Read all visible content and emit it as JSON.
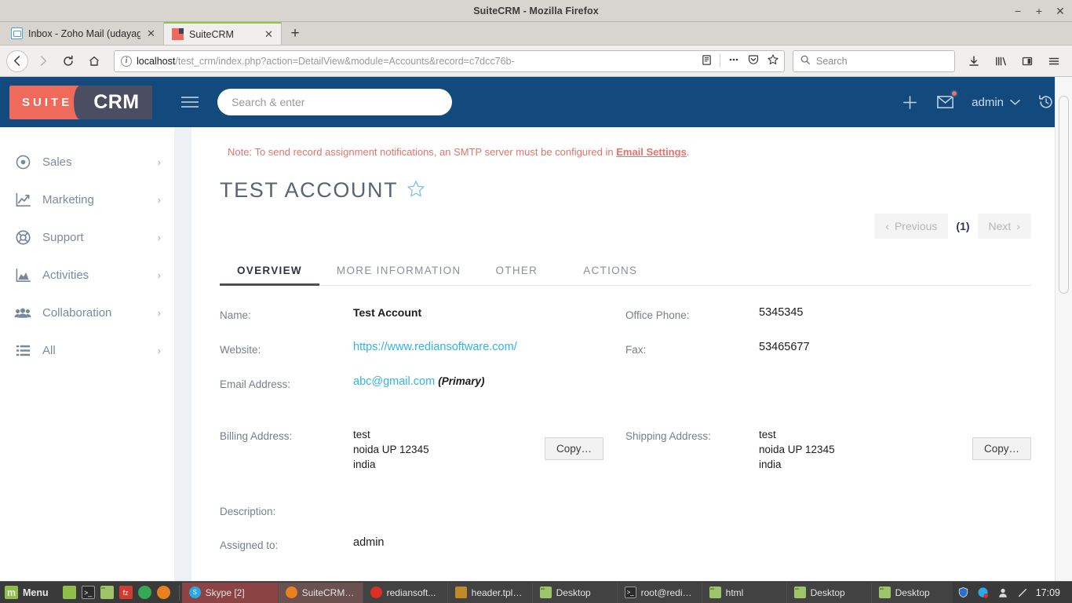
{
  "window": {
    "title": "SuiteCRM - Mozilla Firefox",
    "minimize": "−",
    "maximize": "+",
    "close": "✕"
  },
  "browser": {
    "tabs": [
      {
        "title": "Inbox - Zoho Mail (udayagiri.r",
        "favicon": "zoho-mail-icon",
        "active": false,
        "close": "✕"
      },
      {
        "title": "SuiteCRM",
        "favicon": "suitecrm-icon",
        "active": true,
        "close": "✕"
      }
    ],
    "new_tab_label": "+",
    "nav": {
      "back": "←",
      "forward": "→",
      "reload": "↻",
      "home": "⌂"
    },
    "url": {
      "host": "localhost",
      "path": "/test_crm/index.php?action=DetailView&module=Accounts&record=c7dcc76b-",
      "info_icon": "i"
    },
    "search": {
      "placeholder": "Search",
      "icon": "search-icon"
    },
    "toolbar_icons": [
      "downloads-icon",
      "library-icon",
      "sidebar-icon",
      "menu-icon"
    ],
    "page_icons": [
      "reader-view-icon",
      "page-actions-icon",
      "pocket-icon",
      "bookmark-star-icon"
    ]
  },
  "crm": {
    "logo": {
      "suite": "SUITE",
      "crm": "CRM"
    },
    "menu_icon": "hamburger-menu-icon",
    "search": {
      "placeholder": "Search & enter"
    },
    "header_right": {
      "add_label": "+",
      "messages_icon": "envelope-icon",
      "user": "admin",
      "chevron": "⌄",
      "history_icon": "history-icon"
    },
    "sidebar": {
      "items": [
        {
          "label": "Sales",
          "icon": "target-icon",
          "chevron": "›"
        },
        {
          "label": "Marketing",
          "icon": "chart-line-icon",
          "chevron": "›"
        },
        {
          "label": "Support",
          "icon": "lifebuoy-icon",
          "chevron": "›"
        },
        {
          "label": "Activities",
          "icon": "area-chart-icon",
          "chevron": "›"
        },
        {
          "label": "Collaboration",
          "icon": "users-icon",
          "chevron": "›"
        },
        {
          "label": "All",
          "icon": "list-icon",
          "chevron": "›"
        }
      ]
    },
    "note": {
      "text_before": "Note: To send record assignment notifications, an SMTP server must be configured in ",
      "link": "Email Settings",
      "text_after": "."
    },
    "record": {
      "title": "TEST ACCOUNT",
      "favorite_icon": "star-outline-icon"
    },
    "pager": {
      "previous": "Previous",
      "prev_chevron": "‹",
      "count": "(1)",
      "next": "Next",
      "next_chevron": "›"
    },
    "tabs": [
      {
        "label": "OVERVIEW",
        "active": true
      },
      {
        "label": "MORE INFORMATION",
        "active": false
      },
      {
        "label": "OTHER",
        "active": false
      },
      {
        "label": "ACTIONS",
        "active": false
      }
    ],
    "fields_left": [
      {
        "label": "Name:",
        "value": "Test Account",
        "type": "bold"
      },
      {
        "label": "Website:",
        "value": "https://www.rediansoftware.com/",
        "type": "link"
      },
      {
        "label": "Email Address:",
        "value": "abc@gmail.com",
        "suffix": "(Primary)",
        "type": "email"
      },
      {
        "label": "Billing Address:",
        "type": "address",
        "lines": [
          "test",
          "noida UP  12345",
          "india"
        ],
        "button": "Copy…"
      },
      {
        "label": "Description:",
        "value": "",
        "type": "text"
      },
      {
        "label": "Assigned to:",
        "value": "admin",
        "type": "text"
      }
    ],
    "fields_right": [
      {
        "label": "Office Phone:",
        "value": "5345345",
        "type": "text"
      },
      {
        "label": "Fax:",
        "value": "53465677",
        "type": "text"
      },
      {
        "label": "Shipping Address:",
        "type": "address",
        "lines": [
          "test",
          "noida UP  12345",
          "india"
        ],
        "button": "Copy…"
      }
    ]
  },
  "taskbar": {
    "menu_label": "Menu",
    "quick_launch": [
      "terminal-icon",
      "console-icon",
      "files-icon",
      "filezilla-icon",
      "chrome-icon",
      "firefox-icon"
    ],
    "tasks": [
      {
        "label": "Skype [2]",
        "icon": "skype-icon",
        "state": "active"
      },
      {
        "label": "SuiteCRM - ...",
        "icon": "firefox-icon",
        "state": "focused"
      },
      {
        "label": "rediansoft...",
        "icon": "chrome-icon",
        "state": "normal"
      },
      {
        "label": "header.tpl -...",
        "icon": "editor-icon",
        "state": "normal"
      },
      {
        "label": "Desktop",
        "icon": "folder-icon",
        "state": "normal"
      },
      {
        "label": "root@redia...",
        "icon": "terminal-icon",
        "state": "normal"
      },
      {
        "label": "html",
        "icon": "folder-icon",
        "state": "normal"
      },
      {
        "label": "Desktop",
        "icon": "folder-icon",
        "state": "normal"
      },
      {
        "label": "Desktop",
        "icon": "folder-icon",
        "state": "normal"
      }
    ],
    "tray": [
      "shield-icon",
      "skype-tray-icon",
      "user-icon",
      "brightness-icon"
    ],
    "clock": "17:09"
  },
  "colors": {
    "crm_header_blue": "#134a7e",
    "accent_orange": "#ef6a5a",
    "link_blue": "#32b3e4",
    "note_red": "#e2746a",
    "panel_bg": "#edf0f5"
  }
}
